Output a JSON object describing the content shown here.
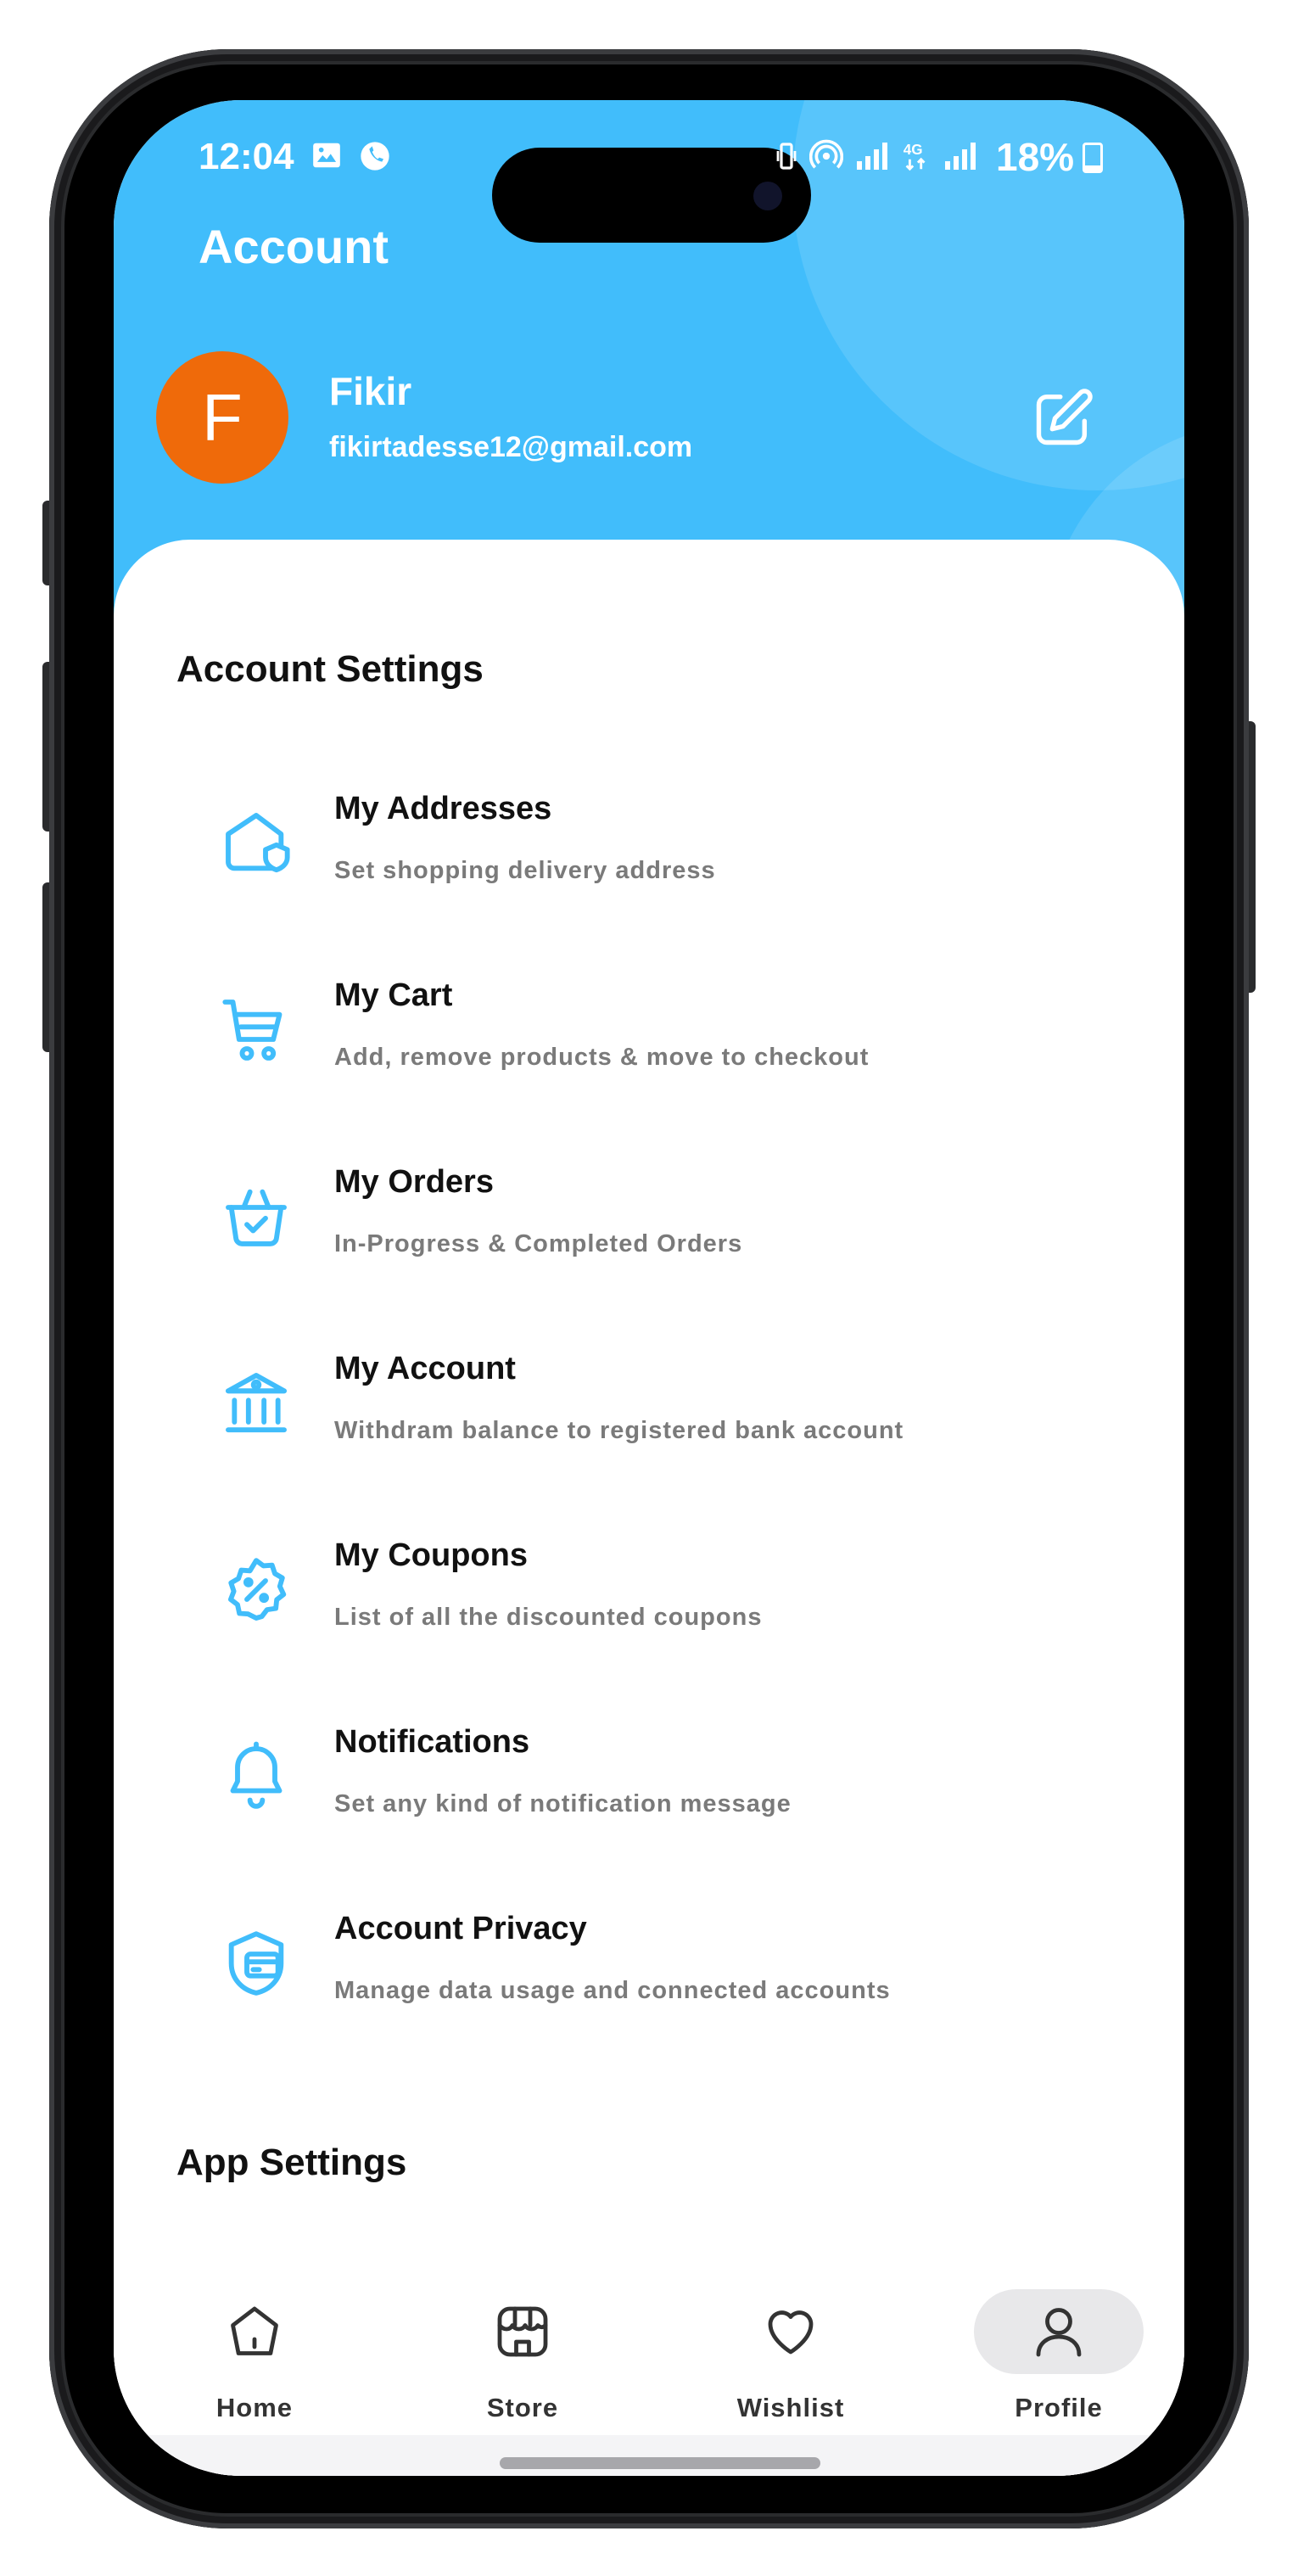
{
  "status_bar": {
    "time": "12:04",
    "battery": "18%"
  },
  "header": {
    "title": "Account",
    "user": {
      "initial": "F",
      "name": "Fikir",
      "email": "fikirtadesse12@gmail.com"
    }
  },
  "account_settings": {
    "title": "Account Settings",
    "items": [
      {
        "icon": "address-icon",
        "title": "My Addresses",
        "subtitle": "Set shopping delivery address"
      },
      {
        "icon": "cart-icon",
        "title": "My Cart",
        "subtitle": "Add, remove products & move to checkout"
      },
      {
        "icon": "orders-icon",
        "title": "My Orders",
        "subtitle": "In-Progress & Completed Orders"
      },
      {
        "icon": "bank-icon",
        "title": "My Account",
        "subtitle": "Withdram balance to registered bank account"
      },
      {
        "icon": "coupon-icon",
        "title": "My Coupons",
        "subtitle": "List of all the discounted coupons"
      },
      {
        "icon": "bell-icon",
        "title": "Notifications",
        "subtitle": "Set any kind of notification message"
      },
      {
        "icon": "privacy-icon",
        "title": "Account Privacy",
        "subtitle": "Manage data usage and connected accounts"
      }
    ]
  },
  "app_settings": {
    "title": "App Settings"
  },
  "bottom_nav": {
    "items": [
      {
        "label": "Home",
        "icon": "home-icon"
      },
      {
        "label": "Store",
        "icon": "store-icon"
      },
      {
        "label": "Wishlist",
        "icon": "heart-icon"
      },
      {
        "label": "Profile",
        "icon": "user-icon",
        "active": true
      }
    ]
  },
  "colors": {
    "accent": "#41bdfb",
    "avatar": "#ef6a0a",
    "icon": "#41bdfb"
  }
}
